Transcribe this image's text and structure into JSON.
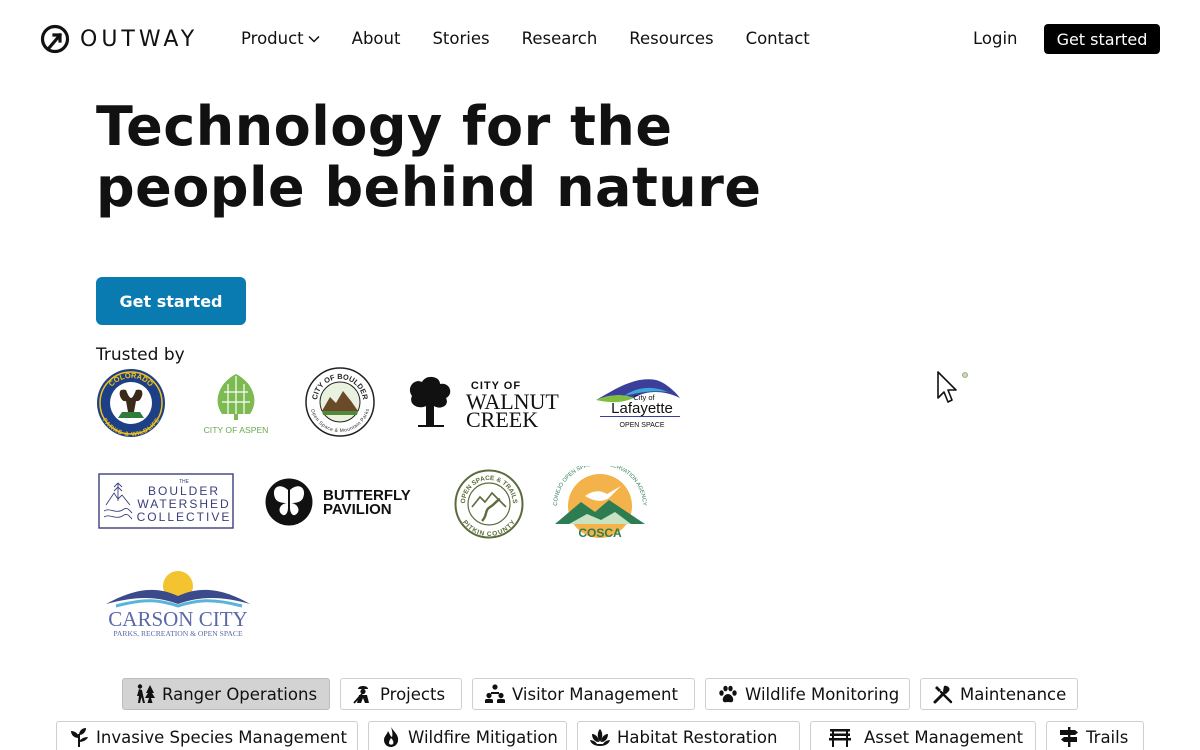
{
  "brand": {
    "name": "OUTWAY"
  },
  "nav": {
    "links": [
      "Product",
      "About",
      "Stories",
      "Research",
      "Resources",
      "Contact"
    ],
    "login": "Login",
    "cta": "Get started"
  },
  "hero": {
    "title_line1": "Technology for the",
    "title_line2": "people behind nature",
    "cta": "Get started",
    "trusted_label": "Trusted by"
  },
  "logos": {
    "cpw": {
      "line1": "COLORADO",
      "line2": "PARKS & WILDLIFE"
    },
    "aspen": {
      "text": "CITY OF ASPEN"
    },
    "boulder": {
      "line1": "CITY OF BOULDER",
      "line2": "Open Space & Mountain Parks"
    },
    "walnut": {
      "line1": "CITY OF",
      "line2": "WALNUT",
      "line3": "CREEK"
    },
    "lafayette": {
      "line1": "City of",
      "line2": "Lafayette",
      "line3": "OPEN SPACE"
    },
    "watershed": {
      "line1": "THE",
      "line2": "BOULDER",
      "line3": "WATERSHED",
      "line4": "COLLECTIVE"
    },
    "butterfly": {
      "line1": "BUTTERFLY",
      "line2": "PAVILION"
    },
    "pitkin": {
      "line1": "OPEN SPACE & TRAILS",
      "line2": "PITKIN COUNTY"
    },
    "cosca": {
      "arc": "CONEJO OPEN SPACE CONSERVATION AGENCY",
      "text": "COSCA"
    },
    "carson": {
      "line1": "CARSON CITY",
      "line2": "PARKS, RECREATION & OPEN SPACE"
    }
  },
  "tabs": [
    {
      "label": "Ranger Operations",
      "icon": "hikers-icon",
      "active": true
    },
    {
      "label": "Projects",
      "icon": "worker-icon",
      "active": false
    },
    {
      "label": "Visitor Management",
      "icon": "people-icon",
      "active": false
    },
    {
      "label": "Wildlife Monitoring",
      "icon": "paw-icon",
      "active": false
    },
    {
      "label": "Maintenance",
      "icon": "tools-icon",
      "active": false
    },
    {
      "label": "Invasive Species Management",
      "icon": "weed-icon",
      "active": false
    },
    {
      "label": "Wildfire Mitigation",
      "icon": "fire-icon",
      "active": false
    },
    {
      "label": "Habitat Restoration",
      "icon": "lotus-icon",
      "active": false
    },
    {
      "label": "Asset Management",
      "icon": "bench-icon",
      "active": false
    },
    {
      "label": "Trails",
      "icon": "signpost-icon",
      "active": false
    }
  ]
}
